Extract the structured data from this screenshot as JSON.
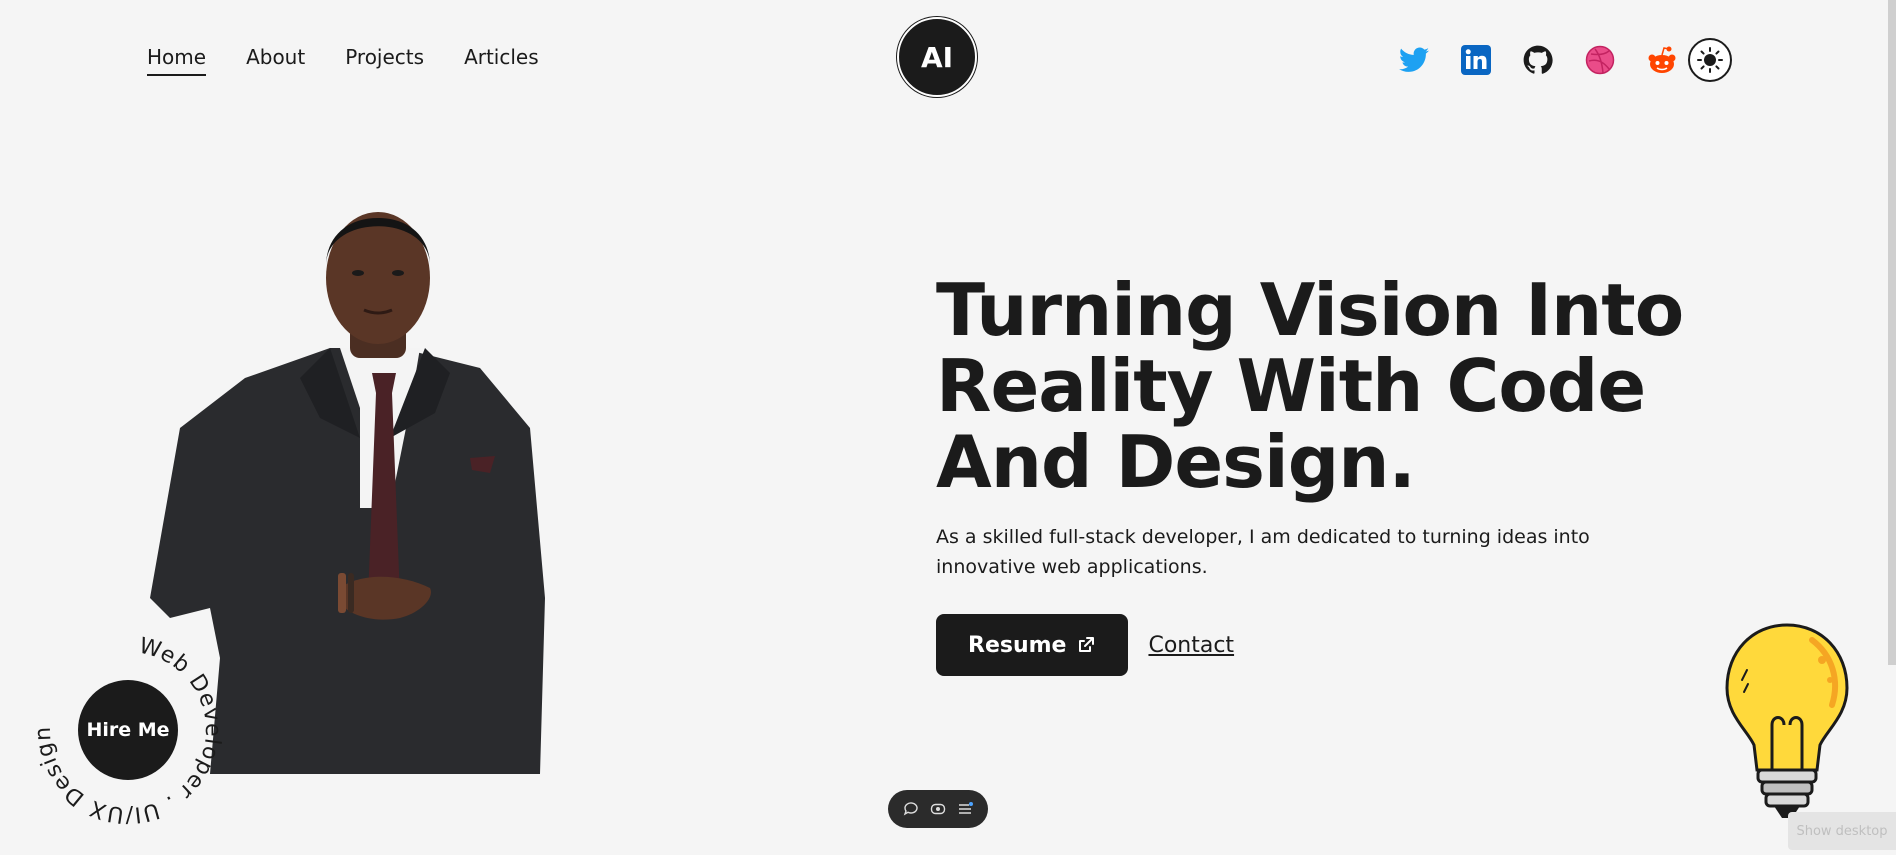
{
  "nav": {
    "items": [
      {
        "label": "Home",
        "active": true
      },
      {
        "label": "About",
        "active": false
      },
      {
        "label": "Projects",
        "active": false
      },
      {
        "label": "Articles",
        "active": false
      }
    ]
  },
  "logo": {
    "text": "AI"
  },
  "socials": {
    "icons": [
      "twitter-icon",
      "linkedin-icon",
      "github-icon",
      "dribbble-icon",
      "reddit-icon"
    ],
    "theme_toggle_icon": "sun-icon"
  },
  "hero": {
    "title_line1": "Turning Vision Into",
    "title_line2": "Reality With Code",
    "title_line3": "And Design.",
    "description": "As a skilled full-stack developer, I am dedicated to turning ideas into innovative web applications.",
    "resume_label": "Resume",
    "contact_label": "Contact"
  },
  "hire": {
    "button_label": "Hire Me",
    "ring_text": "Web Developer . UI/UX Designer . "
  },
  "overlay": {
    "show_desktop_label": "Show desktop"
  },
  "colors": {
    "background": "#f5f5f5",
    "dark": "#1b1b1b",
    "twitter": "#1da1f2",
    "linkedin": "#0a66c2",
    "dribbble": "#ea4c89",
    "reddit": "#ff4500",
    "bulb": "#ffd93b"
  }
}
